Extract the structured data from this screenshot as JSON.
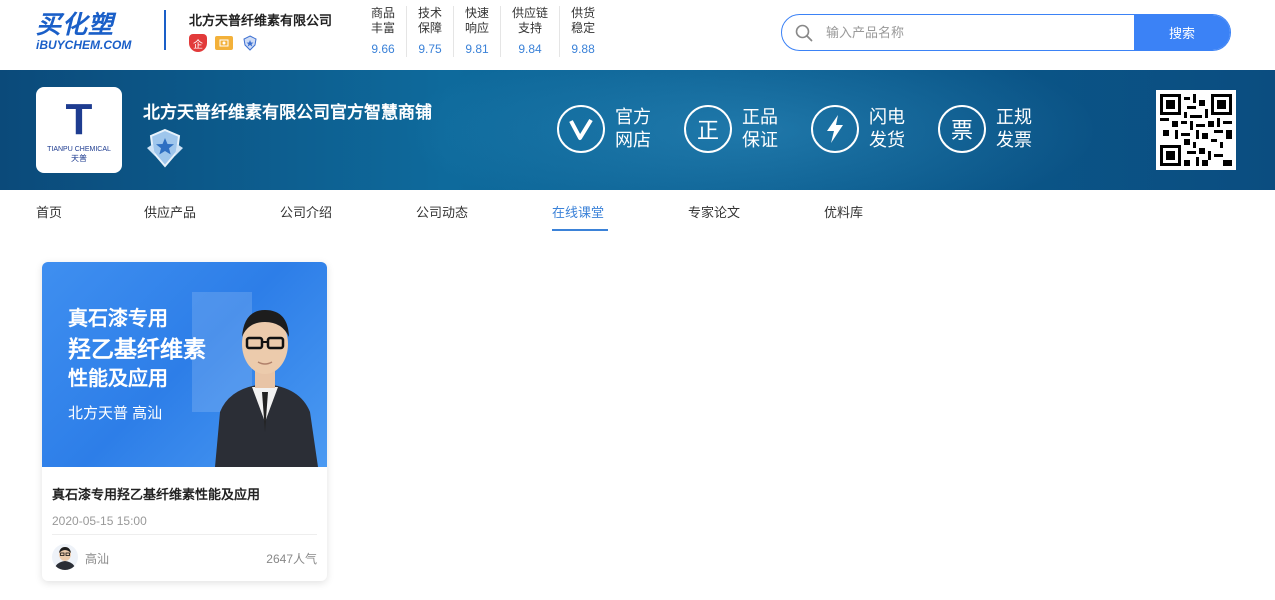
{
  "logo": {
    "cn": "买化塑",
    "en": "iBUYCHEM.COM"
  },
  "company": {
    "name": "北方天普纤维素有限公司",
    "badge_qi": "企"
  },
  "scores": [
    {
      "l1": "商品",
      "l2": "丰富",
      "value": "9.66"
    },
    {
      "l1": "技术",
      "l2": "保障",
      "value": "9.75"
    },
    {
      "l1": "快速",
      "l2": "响应",
      "value": "9.81"
    },
    {
      "l1": "供应链",
      "l2": "支持",
      "value": "9.84"
    },
    {
      "l1": "供货",
      "l2": "稳定",
      "value": "9.88"
    }
  ],
  "search": {
    "placeholder": "输入产品名称",
    "button": "搜索"
  },
  "shop": {
    "logo_letter": "T",
    "logo_en": "TIANPU CHEMICAL",
    "logo_cn": "天普",
    "title": "北方天普纤维素有限公司官方智慧商铺"
  },
  "features": [
    {
      "icon": "V",
      "l1": "官方",
      "l2": "网店"
    },
    {
      "icon": "正",
      "l1": "正品",
      "l2": "保证"
    },
    {
      "icon": "⚡",
      "l1": "闪电",
      "l2": "发货"
    },
    {
      "icon": "票",
      "l1": "正规",
      "l2": "发票"
    }
  ],
  "nav": [
    "首页",
    "供应产品",
    "公司介绍",
    "公司动态",
    "在线课堂",
    "专家论文",
    "优料库"
  ],
  "card": {
    "thumb_l1": "真石漆专用",
    "thumb_l2": "羟乙基纤维素",
    "thumb_l3": "性能及应用",
    "thumb_l4": "北方天普  高汕",
    "title": "真石漆专用羟乙基纤维素性能及应用",
    "date": "2020-05-15 15:00",
    "author": "高汕",
    "views": "2647人气"
  }
}
